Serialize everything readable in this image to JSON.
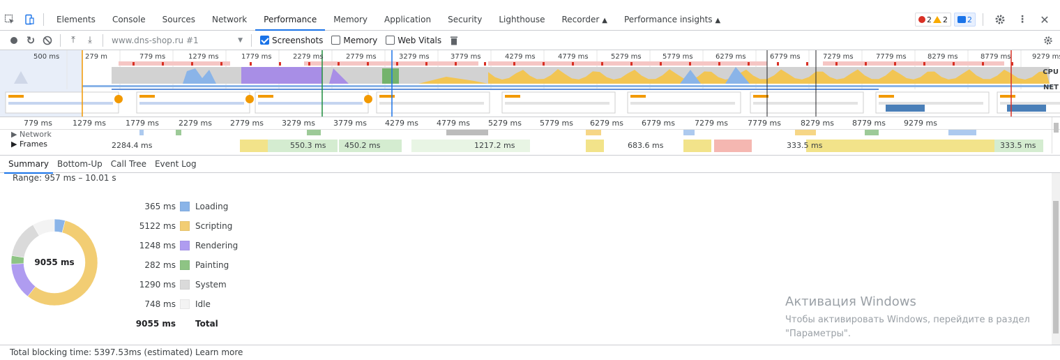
{
  "tabbar": {
    "tabs": [
      "Elements",
      "Console",
      "Sources",
      "Network",
      "Performance",
      "Memory",
      "Application",
      "Security",
      "Lighthouse",
      "Recorder",
      "Performance insights"
    ],
    "active_tab": "Performance",
    "errors": "2",
    "warnings": "2",
    "messages": "2"
  },
  "toolbar": {
    "profile_select": "www.dns-shop.ru #1",
    "screenshots_label": "Screenshots",
    "memory_label": "Memory",
    "webvitals_label": "Web Vitals"
  },
  "overview": {
    "ticks": [
      "500 ms",
      "279 m",
      "779 ms",
      "1279 ms",
      "1779 ms",
      "2279 ms",
      "2779 ms",
      "3279 ms",
      "3779 ms",
      "4279 ms",
      "4779 ms",
      "5279 ms",
      "5779 ms",
      "6279 ms",
      "6779 ms",
      "7279 ms",
      "7779 ms",
      "8279 ms",
      "8779 ms",
      "9279 ms"
    ],
    "cpu_label": "CPU",
    "net_label": "NET"
  },
  "ruler": {
    "ticks": [
      "779 ms",
      "1279 ms",
      "1779 ms",
      "2279 ms",
      "2779 ms",
      "3279 ms",
      "3779 ms",
      "4279 ms",
      "4779 ms",
      "5279 ms",
      "5779 ms",
      "6279 ms",
      "6779 ms",
      "7279 ms",
      "7779 ms",
      "8279 ms",
      "8779 ms",
      "9279 ms"
    ]
  },
  "tracks": {
    "network_label": "Network",
    "frames_label": "Frames",
    "frame_durations": [
      "2284.4 ms",
      "550.3 ms",
      "450.2 ms",
      "1217.2 ms",
      "683.6 ms",
      "333.5 ms",
      "333.5 ms"
    ]
  },
  "subtabs": [
    "Summary",
    "Bottom-Up",
    "Call Tree",
    "Event Log"
  ],
  "summary": {
    "range": "Range: 957 ms – 10.01 s",
    "total_center": "9055 ms",
    "rows": [
      {
        "value": "365 ms",
        "label": "Loading",
        "color": "#8ab4e8",
        "ms": 365
      },
      {
        "value": "5122 ms",
        "label": "Scripting",
        "color": "#f2cd73",
        "ms": 5122
      },
      {
        "value": "1248 ms",
        "label": "Rendering",
        "color": "#af9cf0",
        "ms": 1248
      },
      {
        "value": "282 ms",
        "label": "Painting",
        "color": "#8ec484",
        "ms": 282
      },
      {
        "value": "1290 ms",
        "label": "System",
        "color": "#dadada",
        "ms": 1290
      },
      {
        "value": "748 ms",
        "label": "Idle",
        "color": "#f3f3f3",
        "ms": 748
      }
    ],
    "total_value": "9055 ms",
    "total_label": "Total"
  },
  "windows": {
    "title": "Активация Windows",
    "text": "Чтобы активировать Windows, перейдите в раздел \"Параметры\"."
  },
  "status": "Total blocking time: 5397.53ms (estimated) Learn more"
}
